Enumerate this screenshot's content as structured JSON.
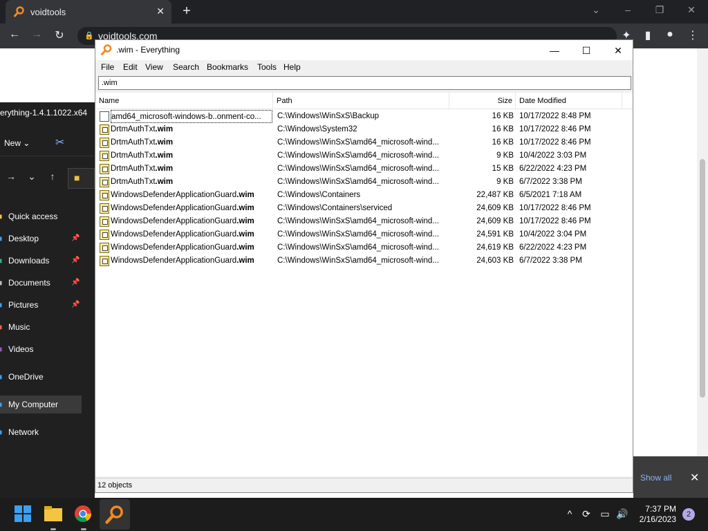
{
  "chrome": {
    "tab_title": "voidtools",
    "url": "voidtools.com",
    "show_all_label": "Show all"
  },
  "explorer": {
    "title": "erything-1.4.1.1022.x64",
    "new_label": "New",
    "nav_items": [
      {
        "label": "Quick access",
        "icon": "star-icon"
      },
      {
        "label": "Desktop",
        "icon": "desktop-icon"
      },
      {
        "label": "Downloads",
        "icon": "download-icon"
      },
      {
        "label": "Documents",
        "icon": "documents-icon"
      },
      {
        "label": "Pictures",
        "icon": "pictures-icon"
      },
      {
        "label": "Music",
        "icon": "music-icon"
      },
      {
        "label": "Videos",
        "icon": "videos-icon"
      },
      {
        "label": "OneDrive",
        "icon": "cloud-icon"
      },
      {
        "label": "My Computer",
        "icon": "computer-icon"
      },
      {
        "label": "Network",
        "icon": "network-icon"
      }
    ]
  },
  "everything": {
    "title": ".wim - Everything",
    "menu": [
      "File",
      "Edit",
      "View",
      "Search",
      "Bookmarks",
      "Tools",
      "Help"
    ],
    "search_value": ".wim",
    "columns": {
      "name": "Name",
      "path": "Path",
      "size": "Size",
      "date": "Date Modified"
    },
    "rows": [
      {
        "name_base": "amd64_microsoft-windows-b..onment-co...",
        "ext": "",
        "path": "C:\\Windows\\WinSxS\\Backup",
        "size": "16 KB",
        "date": "10/17/2022 8:48 PM",
        "type": "generic"
      },
      {
        "name_base": "DrtmAuthTxt",
        "ext": ".wim",
        "path": "C:\\Windows\\System32",
        "size": "16 KB",
        "date": "10/17/2022 8:46 PM",
        "type": "wim"
      },
      {
        "name_base": "DrtmAuthTxt",
        "ext": ".wim",
        "path": "C:\\Windows\\WinSxS\\amd64_microsoft-wind...",
        "size": "16 KB",
        "date": "10/17/2022 8:46 PM",
        "type": "wim"
      },
      {
        "name_base": "DrtmAuthTxt",
        "ext": ".wim",
        "path": "C:\\Windows\\WinSxS\\amd64_microsoft-wind...",
        "size": "9 KB",
        "date": "10/4/2022 3:03 PM",
        "type": "wim"
      },
      {
        "name_base": "DrtmAuthTxt",
        "ext": ".wim",
        "path": "C:\\Windows\\WinSxS\\amd64_microsoft-wind...",
        "size": "15 KB",
        "date": "6/22/2022 4:23 PM",
        "type": "wim"
      },
      {
        "name_base": "DrtmAuthTxt",
        "ext": ".wim",
        "path": "C:\\Windows\\WinSxS\\amd64_microsoft-wind...",
        "size": "9 KB",
        "date": "6/7/2022 3:38 PM",
        "type": "wim"
      },
      {
        "name_base": "WindowsDefenderApplicationGuard",
        "ext": ".wim",
        "path": "C:\\Windows\\Containers",
        "size": "22,487 KB",
        "date": "6/5/2021 7:18 AM",
        "type": "wim"
      },
      {
        "name_base": "WindowsDefenderApplicationGuard",
        "ext": ".wim",
        "path": "C:\\Windows\\Containers\\serviced",
        "size": "24,609 KB",
        "date": "10/17/2022 8:46 PM",
        "type": "wim"
      },
      {
        "name_base": "WindowsDefenderApplicationGuard",
        "ext": ".wim",
        "path": "C:\\Windows\\WinSxS\\amd64_microsoft-wind...",
        "size": "24,609 KB",
        "date": "10/17/2022 8:46 PM",
        "type": "wim"
      },
      {
        "name_base": "WindowsDefenderApplicationGuard",
        "ext": ".wim",
        "path": "C:\\Windows\\WinSxS\\amd64_microsoft-wind...",
        "size": "24,591 KB",
        "date": "10/4/2022 3:04 PM",
        "type": "wim"
      },
      {
        "name_base": "WindowsDefenderApplicationGuard",
        "ext": ".wim",
        "path": "C:\\Windows\\WinSxS\\amd64_microsoft-wind...",
        "size": "24,619 KB",
        "date": "6/22/2022 4:23 PM",
        "type": "wim"
      },
      {
        "name_base": "WindowsDefenderApplicationGuard",
        "ext": ".wim",
        "path": "C:\\Windows\\WinSxS\\amd64_microsoft-wind...",
        "size": "24,603 KB",
        "date": "6/7/2022 3:38 PM",
        "type": "wim"
      }
    ],
    "status": "12 objects"
  },
  "taskbar": {
    "time": "7:37 PM",
    "date": "2/16/2023",
    "notification_count": "2"
  },
  "colors": {
    "everything_accent": "#f08a24",
    "chrome_dark": "#202124",
    "taskbar": "#1c1c1c"
  }
}
